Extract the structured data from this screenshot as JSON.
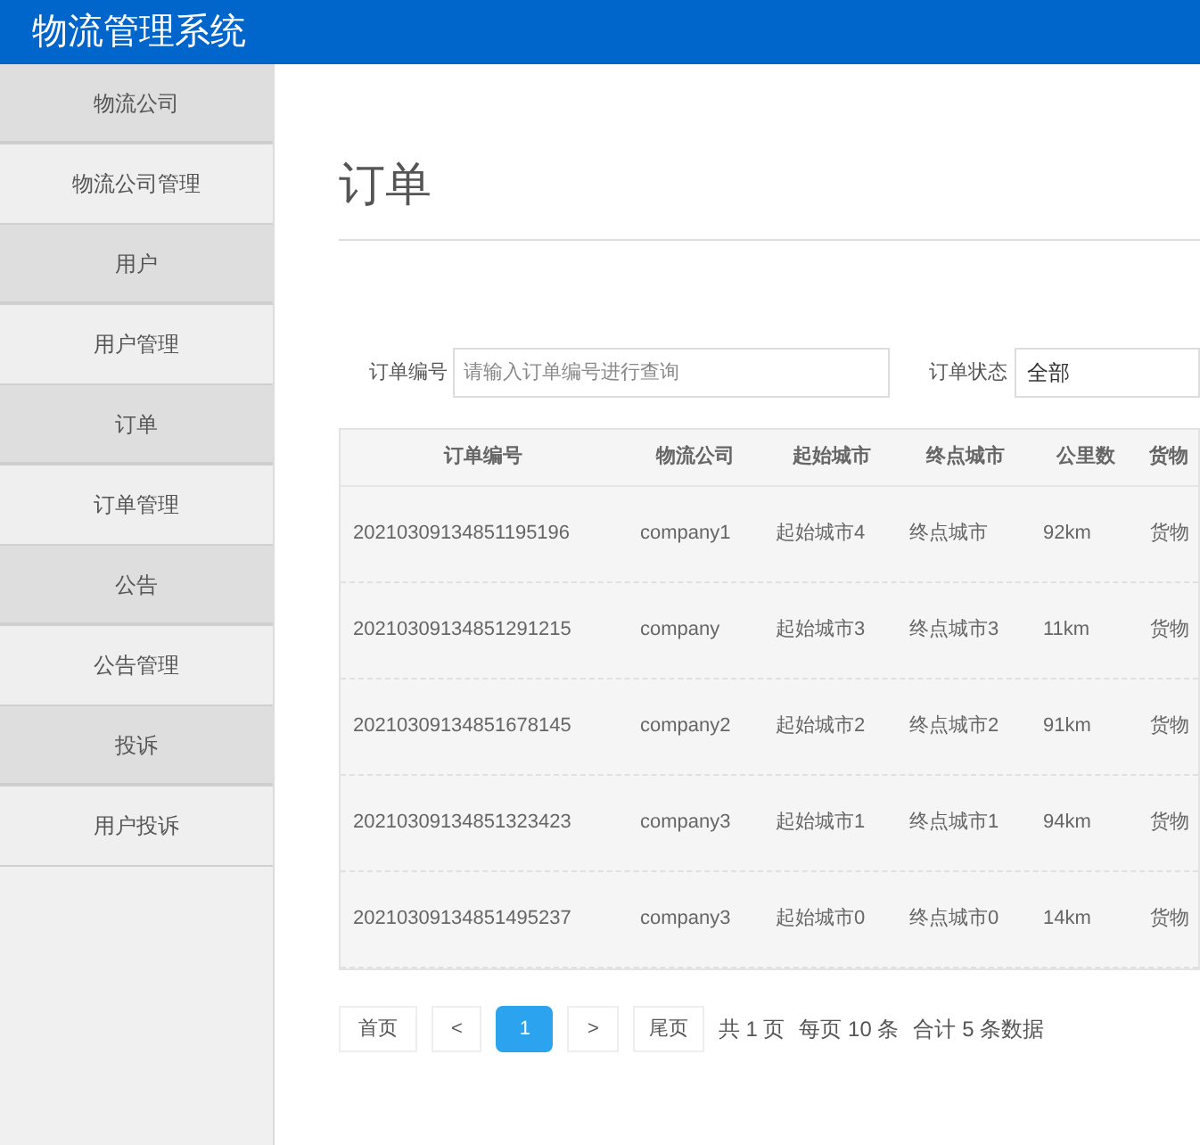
{
  "header": {
    "title": "物流管理系统"
  },
  "sidebar": {
    "items": [
      {
        "kind": "group",
        "label": "物流公司"
      },
      {
        "kind": "link",
        "label": "物流公司管理"
      },
      {
        "kind": "group",
        "label": "用户"
      },
      {
        "kind": "link",
        "label": "用户管理"
      },
      {
        "kind": "group",
        "label": "订单"
      },
      {
        "kind": "link",
        "label": "订单管理"
      },
      {
        "kind": "group",
        "label": "公告"
      },
      {
        "kind": "link",
        "label": "公告管理"
      },
      {
        "kind": "group",
        "label": "投诉"
      },
      {
        "kind": "link",
        "label": "用户投诉"
      }
    ]
  },
  "page": {
    "title": "订单"
  },
  "filters": {
    "order_no": {
      "label": "订单编号",
      "placeholder": "请输入订单编号进行查询"
    },
    "status": {
      "label": "订单状态",
      "value": "全部"
    }
  },
  "table": {
    "columns": [
      "订单编号",
      "物流公司",
      "起始城市",
      "终点城市",
      "公里数",
      "货物"
    ],
    "rows": [
      [
        "20210309134851195196",
        "company1",
        "起始城市4",
        "终点城市",
        "92km",
        "货物"
      ],
      [
        "20210309134851291215",
        "company",
        "起始城市3",
        "终点城市3",
        "11km",
        "货物"
      ],
      [
        "20210309134851678145",
        "company2",
        "起始城市2",
        "终点城市2",
        "91km",
        "货物"
      ],
      [
        "20210309134851323423",
        "company3",
        "起始城市1",
        "终点城市1",
        "94km",
        "货物"
      ],
      [
        "20210309134851495237",
        "company3",
        "起始城市0",
        "终点城市0",
        "14km",
        "货物"
      ]
    ]
  },
  "pagination": {
    "first": "首页",
    "prev": "<",
    "pages": [
      {
        "label": "1",
        "selected": true
      }
    ],
    "next": ">",
    "last": "尾页",
    "info": [
      "共 1 页",
      "每页 10 条",
      "合计 5 条数据"
    ]
  }
}
